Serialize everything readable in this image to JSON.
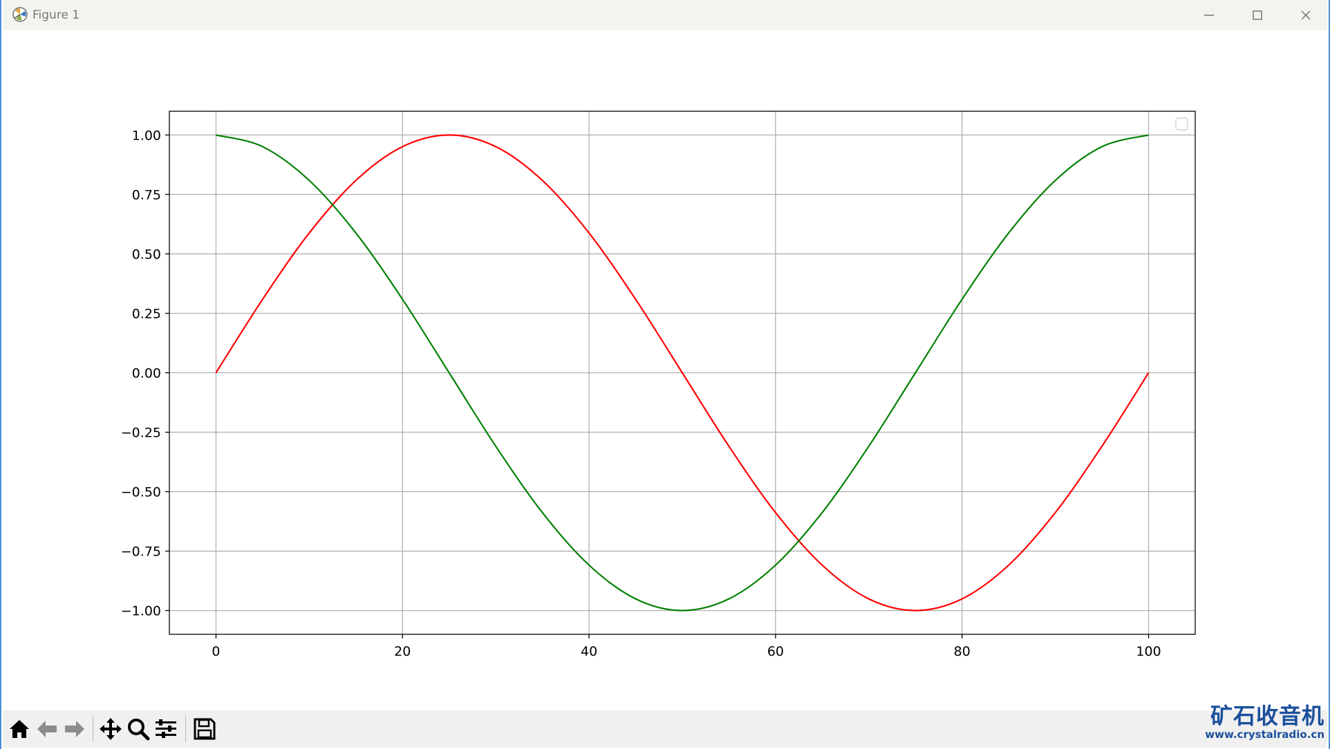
{
  "window": {
    "title": "Figure 1"
  },
  "toolbar": {
    "buttons": [
      "home-icon",
      "back-icon",
      "forward-icon",
      "pan-icon",
      "zoom-icon",
      "configure-subplots-icon",
      "save-icon"
    ]
  },
  "watermark": {
    "main": "矿石收音机",
    "sub": "www.crystalradio.cn"
  },
  "colors": {
    "series1": "#ff0000",
    "series2": "#008000",
    "grid": "#b0b0b0"
  },
  "chart_data": {
    "type": "line",
    "title": "",
    "xlabel": "",
    "ylabel": "",
    "xlim": [
      -5,
      105
    ],
    "ylim": [
      -1.1,
      1.1
    ],
    "grid": true,
    "legend": "top-right",
    "xticks": [
      0,
      20,
      40,
      60,
      80,
      100
    ],
    "xtick_labels": [
      "0",
      "20",
      "40",
      "60",
      "80",
      "100"
    ],
    "yticks": [
      1.0,
      0.75,
      0.5,
      0.25,
      0.0,
      -0.25,
      -0.5,
      -0.75,
      -1.0
    ],
    "ytick_labels": [
      "1.00",
      "0.75",
      "0.50",
      "0.25",
      "0.00",
      "−0.25",
      "−0.50",
      "−0.75",
      "−1.00"
    ],
    "x": [
      0,
      5,
      10,
      15,
      20,
      25,
      30,
      35,
      40,
      45,
      50,
      55,
      60,
      65,
      70,
      75,
      80,
      85,
      90,
      95,
      100
    ],
    "series": [
      {
        "color": "#ff0000",
        "values": [
          0.0,
          0.309,
          0.588,
          0.809,
          0.951,
          1.0,
          0.951,
          0.809,
          0.588,
          0.309,
          0.0,
          -0.309,
          -0.588,
          -0.809,
          -0.951,
          -1.0,
          -0.951,
          -0.809,
          -0.588,
          -0.309,
          0.0
        ]
      },
      {
        "color": "#008000",
        "values": [
          1.0,
          0.951,
          0.809,
          0.588,
          0.309,
          0.0,
          -0.309,
          -0.588,
          -0.809,
          -0.951,
          -1.0,
          -0.951,
          -0.809,
          -0.588,
          -0.309,
          0.0,
          0.309,
          0.588,
          0.809,
          0.951,
          1.0
        ]
      }
    ]
  }
}
